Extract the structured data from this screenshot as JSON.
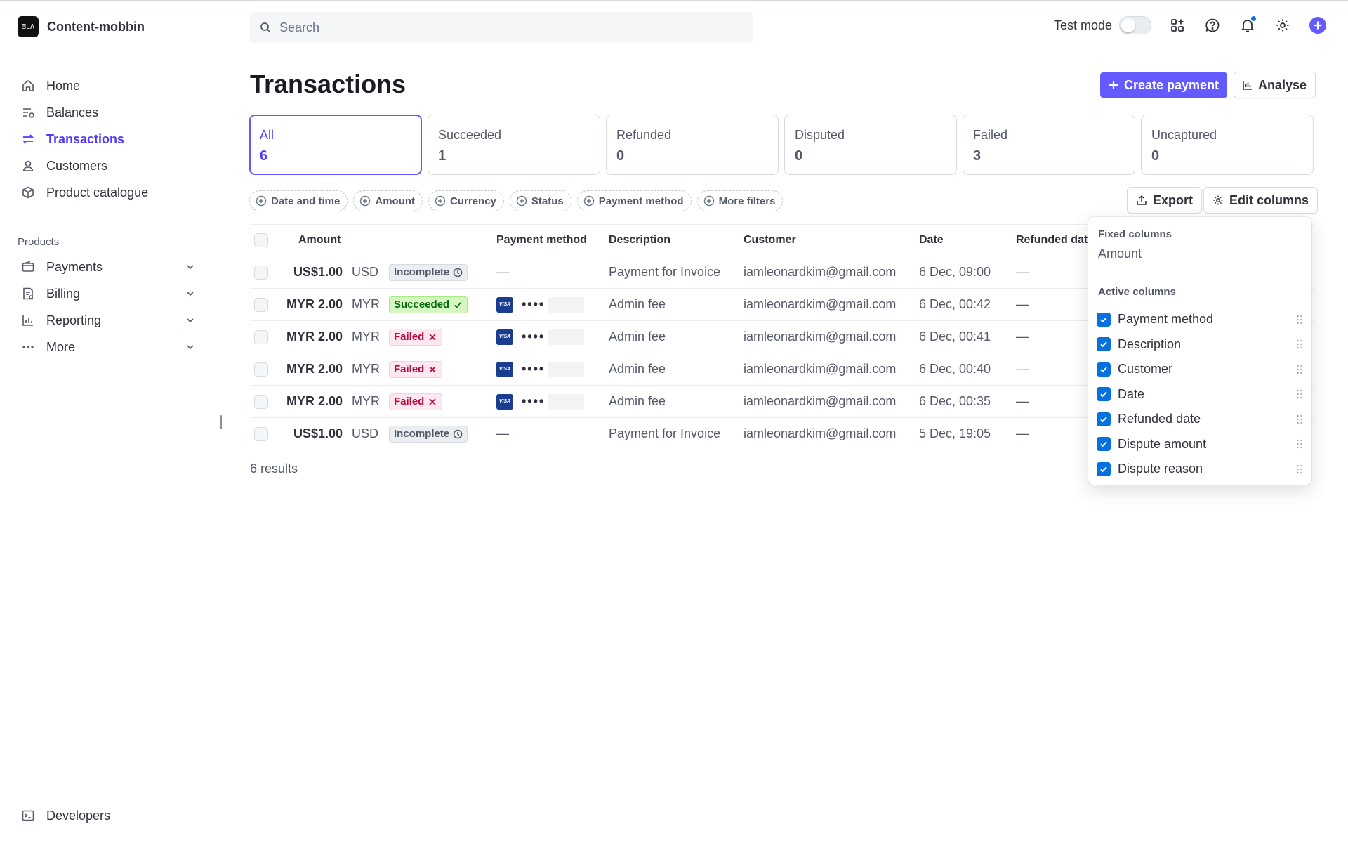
{
  "brand": {
    "logo_text": "ƎLΛ",
    "name": "Content-mobbin"
  },
  "sidebar": {
    "items": [
      {
        "label": "Home",
        "icon": "home-icon"
      },
      {
        "label": "Balances",
        "icon": "balances-icon"
      },
      {
        "label": "Transactions",
        "icon": "transactions-icon",
        "active": true
      },
      {
        "label": "Customers",
        "icon": "customers-icon"
      },
      {
        "label": "Product catalogue",
        "icon": "box-icon"
      }
    ],
    "section_label": "Products",
    "products": [
      {
        "label": "Payments",
        "icon": "wallet-icon"
      },
      {
        "label": "Billing",
        "icon": "billing-icon"
      },
      {
        "label": "Reporting",
        "icon": "chart-icon"
      },
      {
        "label": "More",
        "icon": "more-icon"
      }
    ],
    "developers_label": "Developers"
  },
  "header": {
    "search_placeholder": "Search",
    "test_mode_label": "Test mode",
    "test_mode_on": false
  },
  "page": {
    "title": "Transactions",
    "create_payment_label": "Create payment",
    "analyse_label": "Analyse"
  },
  "tabs": [
    {
      "label": "All",
      "count": "6",
      "active": true
    },
    {
      "label": "Succeeded",
      "count": "1"
    },
    {
      "label": "Refunded",
      "count": "0"
    },
    {
      "label": "Disputed",
      "count": "0"
    },
    {
      "label": "Failed",
      "count": "3"
    },
    {
      "label": "Uncaptured",
      "count": "0"
    }
  ],
  "filters": [
    "Date and time",
    "Amount",
    "Currency",
    "Status",
    "Payment method",
    "More filters"
  ],
  "toolbar": {
    "export_label": "Export",
    "edit_columns_label": "Edit columns"
  },
  "table": {
    "headers": {
      "amount": "Amount",
      "payment_method": "Payment method",
      "description": "Description",
      "customer": "Customer",
      "date": "Date",
      "refunded_date": "Refunded dat"
    },
    "rows": [
      {
        "amount": "US$1.00",
        "currency": "USD",
        "status": "Incomplete",
        "status_type": "incomplete",
        "card": false,
        "method_text": "—",
        "description": "Payment for Invoice",
        "customer": "iamleonardkim@gmail.com",
        "date": "6 Dec, 09:00",
        "refunded": "—"
      },
      {
        "amount": "MYR 2.00",
        "currency": "MYR",
        "status": "Succeeded",
        "status_type": "succeeded",
        "card": true,
        "method_text": "••••",
        "description": "Admin fee",
        "customer": "iamleonardkim@gmail.com",
        "date": "6 Dec, 00:42",
        "refunded": "—"
      },
      {
        "amount": "MYR 2.00",
        "currency": "MYR",
        "status": "Failed",
        "status_type": "failed",
        "card": true,
        "method_text": "••••",
        "description": "Admin fee",
        "customer": "iamleonardkim@gmail.com",
        "date": "6 Dec, 00:41",
        "refunded": "—"
      },
      {
        "amount": "MYR 2.00",
        "currency": "MYR",
        "status": "Failed",
        "status_type": "failed",
        "card": true,
        "method_text": "••••",
        "description": "Admin fee",
        "customer": "iamleonardkim@gmail.com",
        "date": "6 Dec, 00:40",
        "refunded": "—"
      },
      {
        "amount": "MYR 2.00",
        "currency": "MYR",
        "status": "Failed",
        "status_type": "failed",
        "card": true,
        "method_text": "••••",
        "description": "Admin fee",
        "customer": "iamleonardkim@gmail.com",
        "date": "6 Dec, 00:35",
        "refunded": "—"
      },
      {
        "amount": "US$1.00",
        "currency": "USD",
        "status": "Incomplete",
        "status_type": "incomplete",
        "card": false,
        "method_text": "—",
        "description": "Payment for Invoice",
        "customer": "iamleonardkim@gmail.com",
        "date": "5 Dec, 19:05",
        "refunded": "—"
      }
    ],
    "results_label": "6 results"
  },
  "edit_columns_panel": {
    "fixed_heading": "Fixed columns",
    "fixed_columns": [
      "Amount"
    ],
    "active_heading": "Active columns",
    "active_columns": [
      "Payment method",
      "Description",
      "Customer",
      "Date",
      "Refunded date",
      "Dispute amount",
      "Dispute reason"
    ]
  },
  "colors": {
    "accent": "#635bff",
    "active_text": "#533afd",
    "checkbox": "#0570de"
  }
}
